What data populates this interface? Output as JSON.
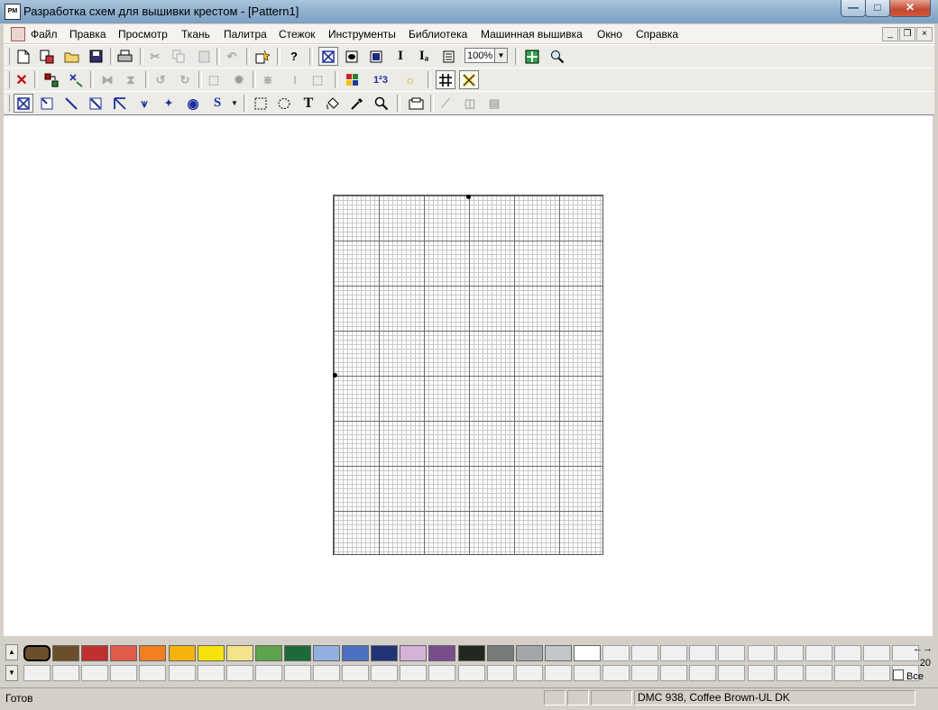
{
  "window": {
    "title": "Разработка схем для вышивки крестом - [Pattern1]",
    "app_icon_label": "PM",
    "minimize_glyph": "—",
    "maximize_glyph": "□",
    "close_glyph": "✕"
  },
  "menu": {
    "items": [
      "Файл",
      "Правка",
      "Просмотр",
      "Ткань",
      "Палитра",
      "Стежок",
      "Инструменты",
      "Библиотека",
      "Машинная вышивка",
      "Окно",
      "Справка"
    ],
    "mdi_min": "_",
    "mdi_restore": "❐",
    "mdi_close": "×"
  },
  "toolbar1": {
    "zoom_value": "100%",
    "icons": [
      "new-icon",
      "new-from-image-icon",
      "open-icon",
      "save-icon",
      "print-icon",
      "cut-icon",
      "copy-icon",
      "paste-icon",
      "undo-icon",
      "insert-icon",
      "help-icon",
      "full-cross-view-icon",
      "symbol-view-icon",
      "block-view-icon",
      "single-icon",
      "text-view-icon",
      "list-icon",
      "fit-icon",
      "zoom-icon"
    ]
  },
  "toolbar2": {
    "counter_label": "1²3",
    "icons": [
      "delete-icon",
      "replace-color-icon",
      "swap-icon",
      "flip-horizontal-icon",
      "flip-vertical-icon",
      "rotate-left-icon",
      "rotate-right-icon",
      "select-all-icon",
      "gear-icon",
      "mirror-icon",
      "half-icon",
      "frame-icon",
      "color-palette-icon",
      "numbering-icon",
      "sun-icon",
      "grid-icon",
      "cross-icon"
    ]
  },
  "toolbar3": {
    "icons": [
      "full-stitch-icon",
      "half-stitch-icon",
      "quarter-stitch-icon",
      "three-quarter-stitch-icon",
      "backstitch-icon",
      "long-stitch-icon",
      "french-knot-icon",
      "bead-icon",
      "special-stitch-icon",
      "rect-select-icon",
      "lasso-select-icon",
      "text-tool-icon",
      "fill-tool-icon",
      "eyedropper-icon",
      "magnifier-icon",
      "fabric-icon",
      "measure-icon",
      "split-view-icon",
      "layers-icon"
    ]
  },
  "pattern": {
    "grid_columns": 60,
    "grid_rows": 80
  },
  "palette": {
    "colors": [
      "#6b4f2a",
      "#6b4f2a",
      "#c0302f",
      "#e25a4a",
      "#f28020",
      "#f6b40a",
      "#f7e20d",
      "#f2e38a",
      "#5ea24b",
      "#1c6a3a",
      "#8fb0e0",
      "#4a70c0",
      "#233476",
      "#d7b2d8",
      "#7b4c8c",
      "#222820",
      "#777b7c",
      "#a3a7aa",
      "#c1c7c8",
      "#ffffff"
    ],
    "empty_slots_row1": 11,
    "empty_slots_row2": 31,
    "count": "20",
    "all_label": "Все",
    "nav": "←→"
  },
  "status": {
    "ready": "Готов",
    "color_info": "DMC  938, Coffee Brown-UL DK"
  }
}
